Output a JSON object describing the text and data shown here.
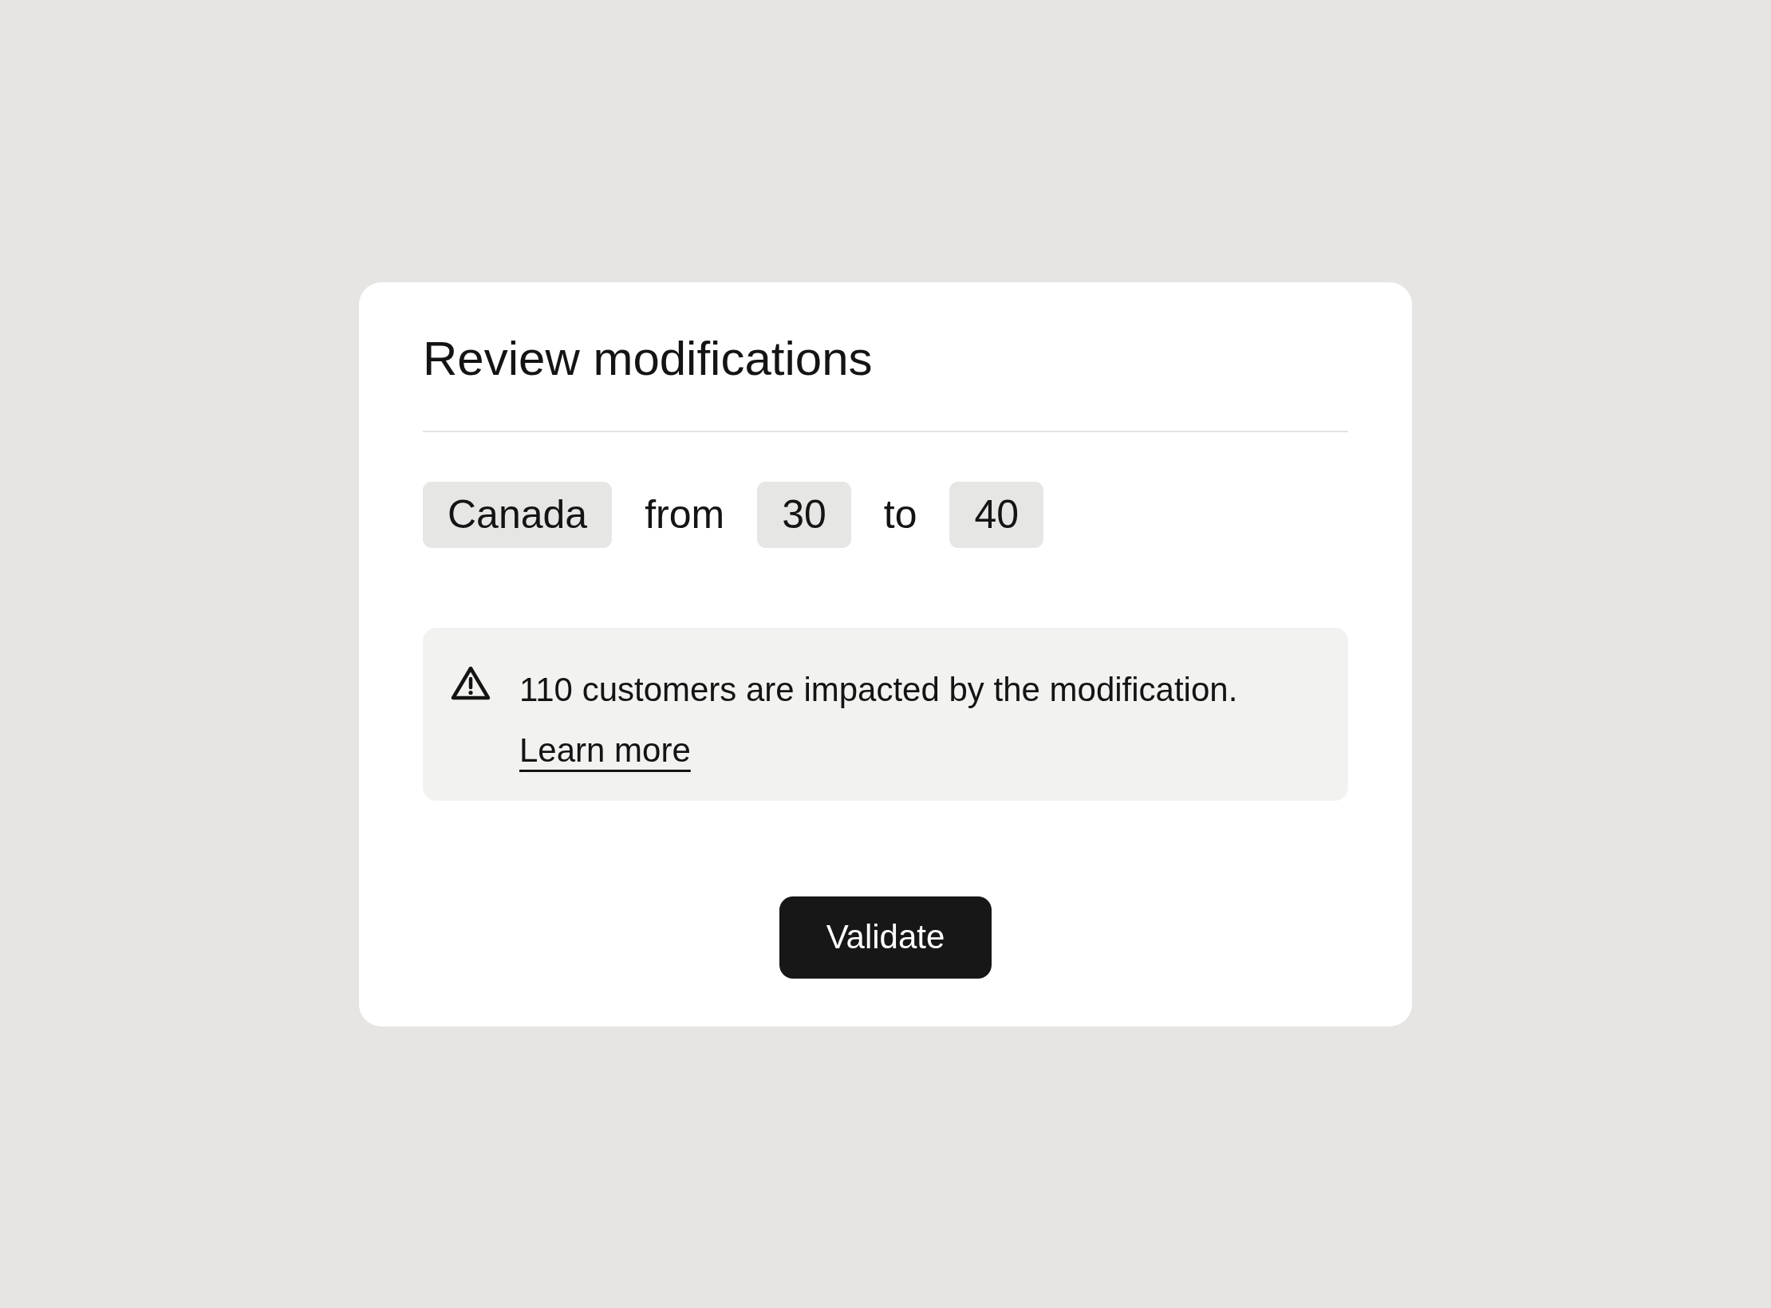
{
  "dialog": {
    "title": "Review modifications",
    "rule": [
      {
        "kind": "chip",
        "text": "Canada"
      },
      {
        "kind": "word",
        "text": "from"
      },
      {
        "kind": "chip",
        "text": "30"
      },
      {
        "kind": "word",
        "text": "to"
      },
      {
        "kind": "chip",
        "text": "40"
      }
    ],
    "warning": {
      "message": "110 customers are impacted by the modification.",
      "link": "Learn more"
    },
    "button": {
      "label": "Validate"
    }
  }
}
